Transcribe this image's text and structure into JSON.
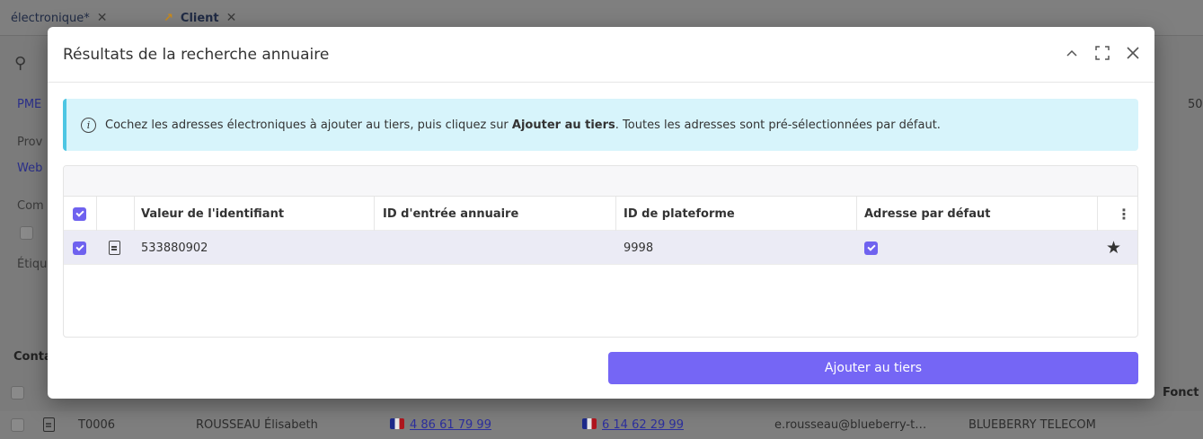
{
  "background": {
    "tabs": [
      {
        "label": "électronique*"
      },
      {
        "label": "Client"
      }
    ],
    "side_texts": [
      "PME",
      "Prov",
      "Web",
      "Com",
      "Étiqu",
      "Conta"
    ],
    "right_text": "50",
    "fonction_header": "Fonct",
    "contact_row": {
      "code": "T0006",
      "name": "ROUSSEAU Élisabeth",
      "phone1": "4 86 61 79 99",
      "phone2": "6 14 62 29 99",
      "email": "e.rousseau@blueberry-t…",
      "company": "BLUEBERRY TELECOM"
    }
  },
  "modal": {
    "title": "Résultats de la recherche annuaire",
    "info": {
      "before": "Cochez les adresses électroniques à ajouter au tiers, puis cliquez sur ",
      "bold": "Ajouter au tiers",
      "after": ". Toutes les adresses sont pré-sélectionnées par défaut."
    },
    "columns": {
      "identifier": "Valeur de l'identifiant",
      "entry_id": "ID d'entrée annuaire",
      "platform_id": "ID de plateforme",
      "default_address": "Adresse par défaut"
    },
    "rows": [
      {
        "identifier": "533880902",
        "entry_id": "",
        "platform_id": "9998",
        "default_checked": true,
        "selected": true
      }
    ],
    "button_label": "Ajouter au tiers"
  },
  "colors": {
    "accent": "#7566f5",
    "info_bg": "#d7f4fb",
    "info_border": "#4ec6e3",
    "row_selected": "#ebebf5"
  }
}
